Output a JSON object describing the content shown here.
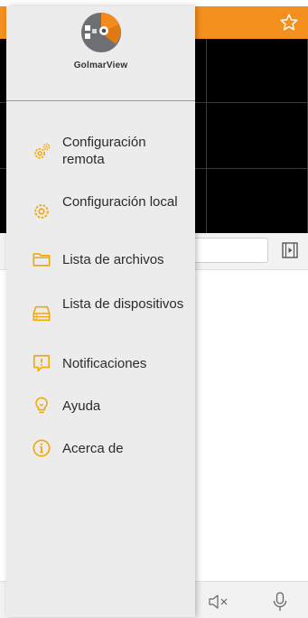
{
  "app": {
    "brand": "GolmarView"
  },
  "menu": {
    "items": [
      {
        "label": "Configuración remota",
        "icon": "remote-settings-icon"
      },
      {
        "label": "Configuración local",
        "icon": "gear-icon"
      },
      {
        "label": "Lista de archivos",
        "icon": "folder-icon"
      },
      {
        "label": "Lista de dispositivos",
        "icon": "device-list-icon"
      },
      {
        "label": "Notificaciones",
        "icon": "notification-icon"
      },
      {
        "label": "Ayuda",
        "icon": "lightbulb-icon"
      },
      {
        "label": "Acerca de",
        "icon": "info-icon"
      }
    ]
  },
  "colors": {
    "accent": "#f4901e",
    "icon": "#f0a80f",
    "drawer": "#ececec"
  }
}
